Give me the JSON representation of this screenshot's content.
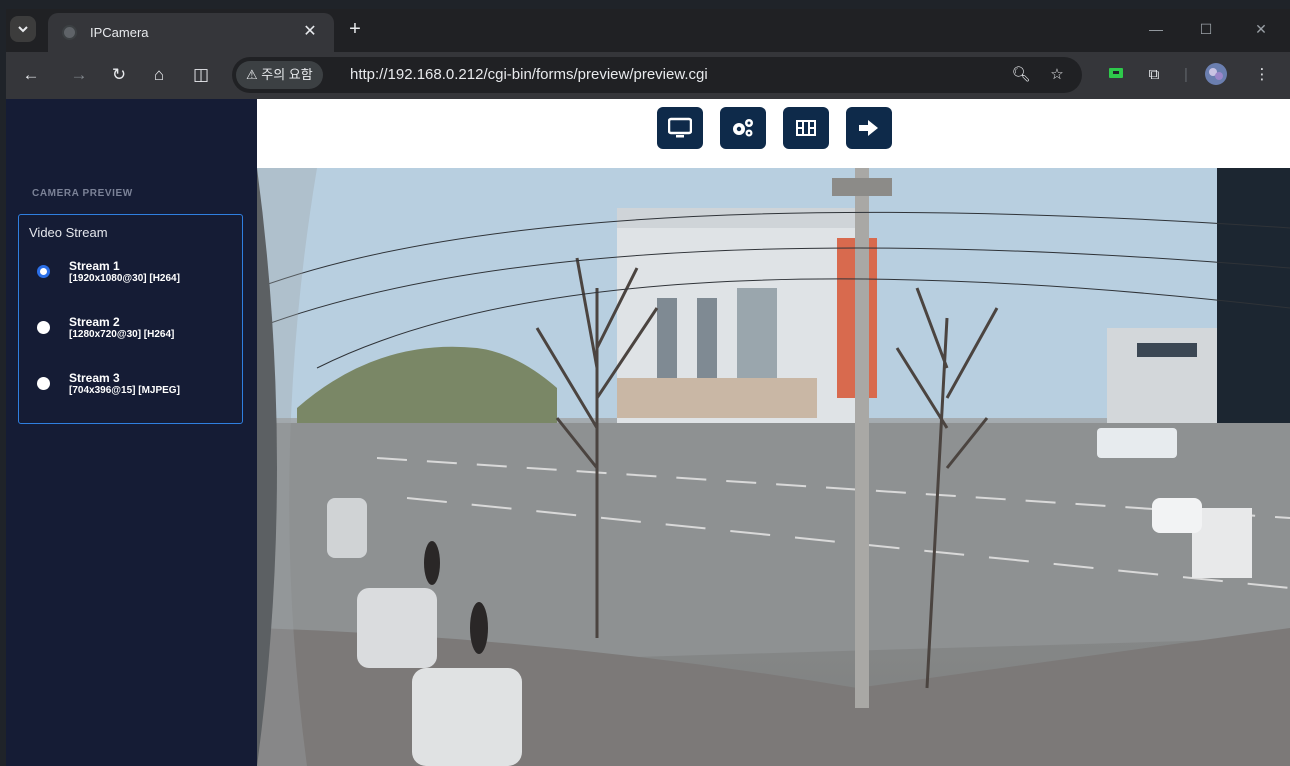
{
  "browser": {
    "tab_title": "IPCamera",
    "tab_close": "✕",
    "new_tab": "+",
    "security_chip": "⚠ 주의 요함",
    "url": "http://192.168.0.212/cgi-bin/forms/preview/preview.cgi",
    "icons": [
      "tab-search-icon",
      "globe-icon",
      "back-icon",
      "forward-icon",
      "reload-icon",
      "home-icon",
      "split-view-icon",
      "zoom-icon",
      "star-icon",
      "extension-icon",
      "puzzle-icon",
      "profile-avatar",
      "menu-icon",
      "minimize-icon",
      "maximize-icon",
      "window-close-icon"
    ]
  },
  "sidebar": {
    "section_title": "CAMERA PREVIEW",
    "stream_box_title": "Video Stream",
    "streams": [
      {
        "name": "Stream 1",
        "spec": "[1920x1080@30] [H264]",
        "selected": true
      },
      {
        "name": "Stream 2",
        "spec": "[1280x720@30] [H264]",
        "selected": false
      },
      {
        "name": "Stream 3",
        "spec": "[704x396@15] [MJPEG]",
        "selected": false
      }
    ]
  },
  "toolbar_buttons": [
    "monitor-icon",
    "settings-gears-icon",
    "film-icon",
    "logout-icon"
  ],
  "colors": {
    "sidebar_bg": "#151c35",
    "accent": "#2f7fe0",
    "topbtn_bg": "#0e2a4a"
  }
}
